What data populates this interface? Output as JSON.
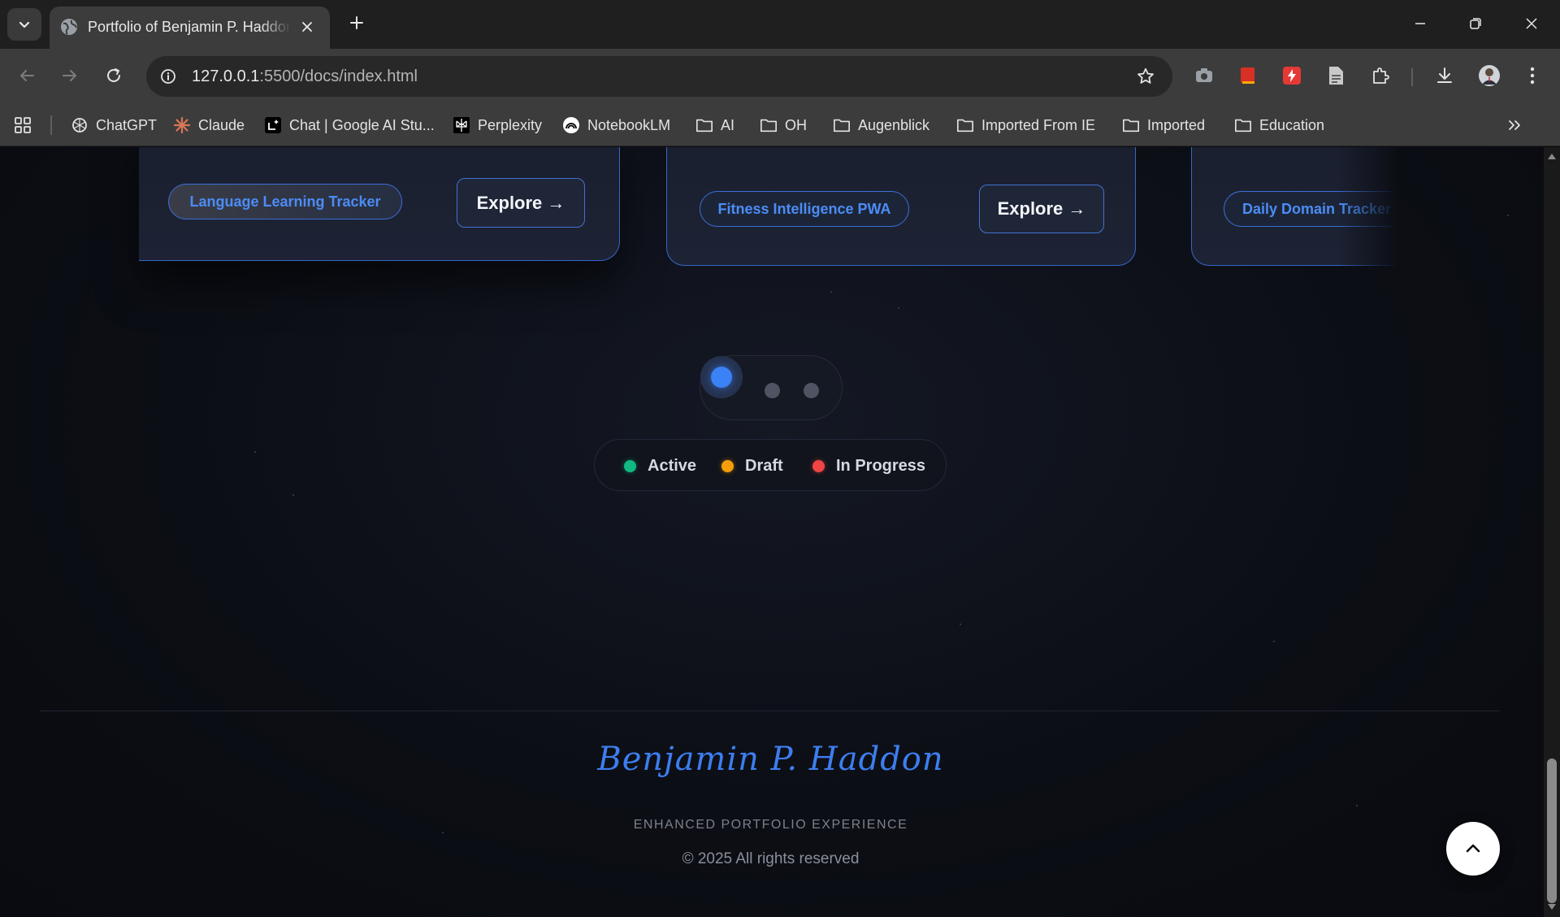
{
  "browser": {
    "tab": {
      "title": "Portfolio of Benjamin P. Haddon"
    },
    "address_bar": {
      "host": "127.0.0.1",
      "rest": ":5500/docs/index.html"
    },
    "bookmarks": [
      {
        "label": "ChatGPT",
        "icon": "chatgpt-icon"
      },
      {
        "label": "Claude",
        "icon": "claude-icon"
      },
      {
        "label": "Chat | Google AI Stu...",
        "icon": "google-ai-studio-icon"
      },
      {
        "label": "Perplexity",
        "icon": "perplexity-icon"
      },
      {
        "label": "NotebookLM",
        "icon": "notebooklm-icon"
      },
      {
        "label": "AI",
        "icon": "folder-icon"
      },
      {
        "label": "OH",
        "icon": "folder-icon"
      },
      {
        "label": "Augenblick",
        "icon": "folder-icon"
      },
      {
        "label": "Imported From IE",
        "icon": "folder-icon"
      },
      {
        "label": "Imported",
        "icon": "folder-icon"
      },
      {
        "label": "Education",
        "icon": "folder-icon"
      }
    ]
  },
  "cards": [
    {
      "pill": "Language Learning Tracker",
      "button": "Explore →"
    },
    {
      "pill": "Fitness Intelligence PWA",
      "button": "Explore →"
    },
    {
      "pill": "Daily Domain Tracker"
    }
  ],
  "carousel": {
    "active_index": 1,
    "count": 3
  },
  "legend": [
    {
      "label": "Active",
      "color": "#10b981"
    },
    {
      "label": "Draft",
      "color": "#f59e0b"
    },
    {
      "label": "In Progress",
      "color": "#ef4444"
    }
  ],
  "footer": {
    "signature": "Benjamin P. Haddon",
    "tagline": "ENHANCED PORTFOLIO EXPERIENCE",
    "copyright": "© 2025 All rights reserved"
  },
  "colors": {
    "accent": "#3b82f6",
    "background": "#0b0d13"
  }
}
